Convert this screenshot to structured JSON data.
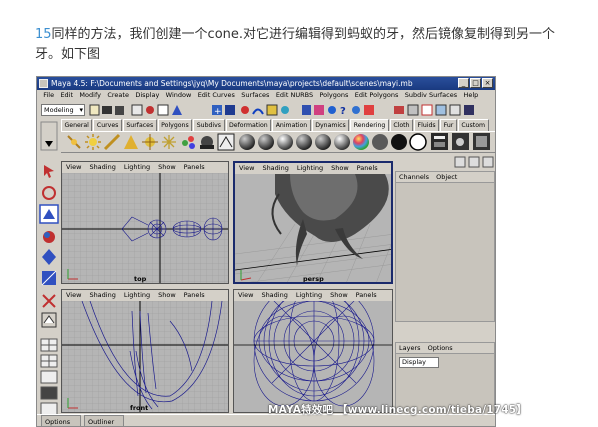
{
  "paragraph": {
    "number": "15",
    "text_line1": "同样的方法，我们创建一个cone.对它进行编辑得到蚂蚁的牙，然后镜像复制得到另一个",
    "text_line2": "牙。如下图"
  },
  "window": {
    "title": "Maya 4.5: F:\\Documents and Settings\\jyq\\My Documents\\maya\\projects\\default\\scenes\\mayi.mb",
    "controls": [
      "_",
      "□",
      "×"
    ]
  },
  "menu": [
    "File",
    "Edit",
    "Modify",
    "Create",
    "Display",
    "Window",
    "Edit Curves",
    "Surfaces",
    "Edit NURBS",
    "Polygons",
    "Edit Polygons",
    "Subdiv Surfaces",
    "Help"
  ],
  "mode_selector": {
    "value": "Modeling"
  },
  "shelf_tabs": [
    "General",
    "Curves",
    "Surfaces",
    "Polygons",
    "Subdivs",
    "Deformation",
    "Animation",
    "Dynamics",
    "Rendering",
    "Cloth",
    "Fluids",
    "Fur",
    "Custom"
  ],
  "shelf_active_tab": "Rendering",
  "viewport_menu": [
    "View",
    "Shading",
    "Lighting",
    "Show",
    "Panels"
  ],
  "viewports": [
    {
      "name": "top",
      "label": "top"
    },
    {
      "name": "persp",
      "label": "persp"
    },
    {
      "name": "front",
      "label": "front"
    },
    {
      "name": "side",
      "label": ""
    }
  ],
  "channel_box": {
    "tabs": [
      "Channels",
      "Object"
    ]
  },
  "layers": {
    "tabs": [
      "Layers",
      "Options"
    ],
    "display_value": "Display"
  },
  "taskbar": [
    "Options",
    "Outliner"
  ],
  "watermark": "MAYA特效吧 【www.linecg.com/tieba/1745】",
  "colors": {
    "title_bar": "#1f4590",
    "ui_gray": "#d4d0c8",
    "viewport_bg": "#b5b5b5",
    "wire": "#1a1a8c",
    "paragraph_number": "#3c8fd0"
  }
}
